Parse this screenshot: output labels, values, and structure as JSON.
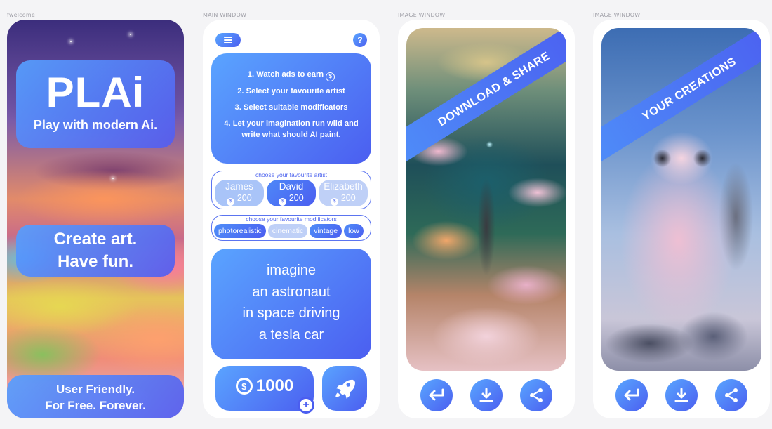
{
  "labels": {
    "welcome": "fwelcome",
    "main": "MAIN WINDOW",
    "image1": "IMAGE WINDOW",
    "image2": "IMAGE WINDOW"
  },
  "welcome": {
    "logo": "PLAi",
    "tagline": "Play with modern Ai.",
    "create_line1": "Create art.",
    "create_line2": "Have fun.",
    "user_line1": "User Friendly.",
    "user_line2": "For Free. Forever."
  },
  "main": {
    "help": "?",
    "instructions": {
      "step1": "1. Watch ads to earn",
      "step2": "2. Select your favourite artist",
      "step3": "3. Select suitable modificators",
      "step4a": "4. Let your imagination run wild and",
      "step4b": "write what should AI paint."
    },
    "artists_title": "choose your favourite artist",
    "artists": [
      {
        "name": "James",
        "price": "200"
      },
      {
        "name": "David",
        "price": "200"
      },
      {
        "name": "Elizabeth",
        "price": "200"
      }
    ],
    "mods_title": "choose your favourite modificators",
    "mods": [
      "photorealistic",
      "cinematic",
      "vintage",
      "low"
    ],
    "prompt": [
      "imagine",
      "an astronaut",
      "in space driving",
      "a tesla car"
    ],
    "balance": "1000",
    "coin_symbol": "$",
    "plus": "+"
  },
  "image1": {
    "ribbon": "DOWNLOAD & SHARE"
  },
  "image2": {
    "ribbon": "YOUR CREATIONS"
  },
  "colors": {
    "accent_start": "#5aa4ff",
    "accent_end": "#4b5ef0"
  }
}
